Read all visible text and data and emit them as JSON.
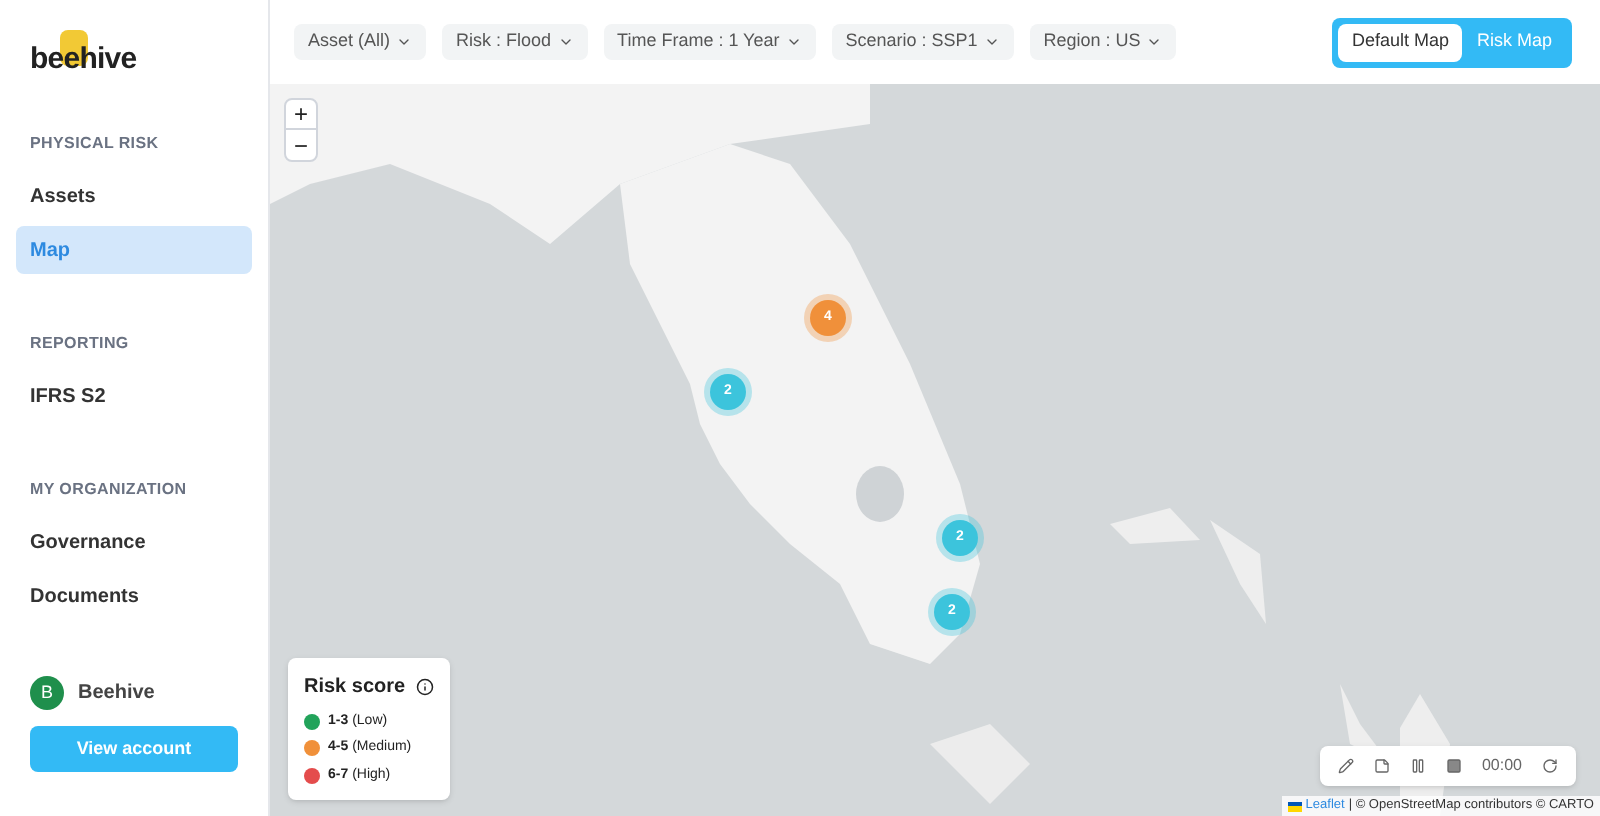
{
  "logo": "beehive",
  "sidebar": {
    "sections": [
      {
        "heading": "PHYSICAL RISK",
        "items": [
          {
            "label": "Assets",
            "selected": false
          },
          {
            "label": "Map",
            "selected": true
          }
        ]
      },
      {
        "heading": "REPORTING",
        "items": [
          {
            "label": "IFRS S2",
            "selected": false
          }
        ]
      },
      {
        "heading": "MY ORGANIZATION",
        "items": [
          {
            "label": "Governance",
            "selected": false
          },
          {
            "label": "Documents",
            "selected": false
          }
        ]
      }
    ],
    "account": {
      "initial": "B",
      "name": "Beehive",
      "button": "View account"
    }
  },
  "filters": [
    {
      "label": "Asset (All)"
    },
    {
      "label": "Risk : Flood"
    },
    {
      "label": "Time Frame : 1 Year"
    },
    {
      "label": "Scenario : SSP1"
    },
    {
      "label": "Region : US"
    }
  ],
  "map_toggle": [
    {
      "label": "Default Map",
      "selected": true
    },
    {
      "label": "Risk Map",
      "selected": false
    }
  ],
  "zoom": {
    "in": "+",
    "out": "−"
  },
  "markers": [
    {
      "count": "4",
      "color": "#f0903a"
    },
    {
      "count": "2",
      "color": "#3cc4dc"
    },
    {
      "count": "2",
      "color": "#3cc4dc"
    },
    {
      "count": "2",
      "color": "#3cc4dc"
    }
  ],
  "legend": {
    "title": "Risk score",
    "items": [
      {
        "range": "1-3",
        "label": "(Low)",
        "color": "#22a35a"
      },
      {
        "range": "4-5",
        "label": "(Medium)",
        "color": "#f0903a"
      },
      {
        "range": "6-7",
        "label": "(High)",
        "color": "#e44c4c"
      }
    ]
  },
  "recorder": {
    "time": "00:00"
  },
  "attribution": {
    "link": "Leaflet",
    "text": "| © OpenStreetMap contributors © CARTO"
  }
}
